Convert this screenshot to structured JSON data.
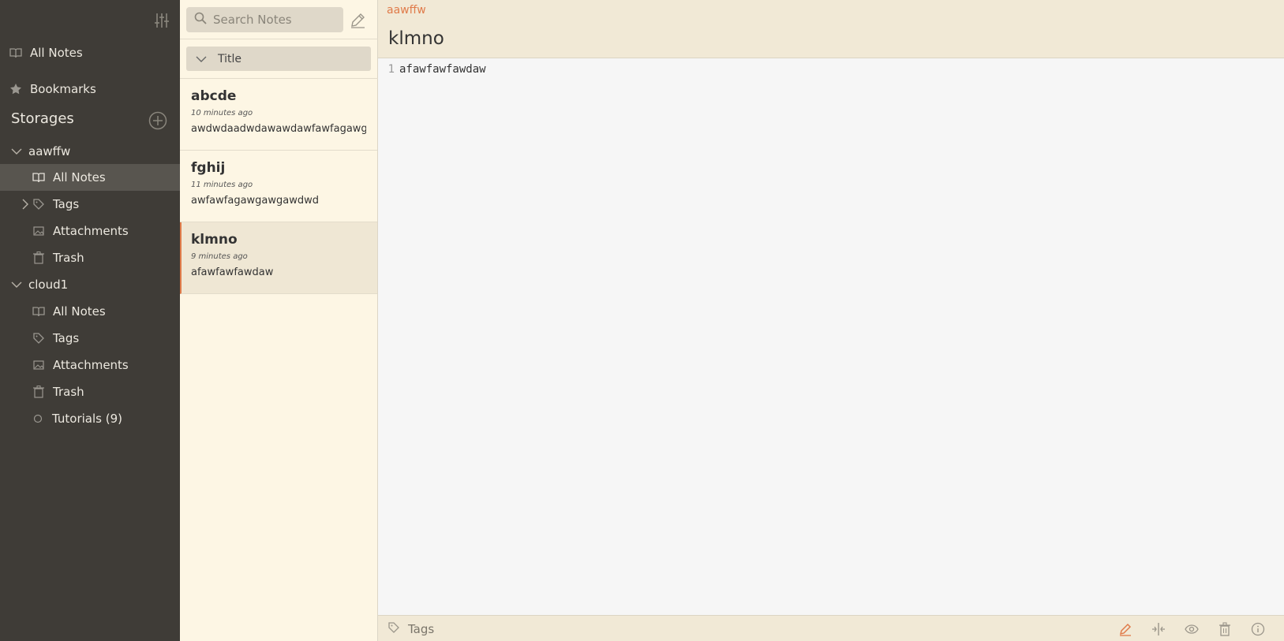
{
  "colors": {
    "sidebar_bg": "#3f3c37",
    "notelist_bg": "#fdf6e4",
    "header_bg": "#f1e9d6",
    "accent": "#e07b4a"
  },
  "sidebar": {
    "toggle_icon": "sliders-icon",
    "all_notes": "All Notes",
    "bookmarks": "Bookmarks",
    "storages_header": "Storages",
    "storages": [
      {
        "name": "aawffw",
        "items": [
          {
            "label": "All Notes",
            "icon": "book-icon"
          },
          {
            "label": "Tags",
            "icon": "tag-icon"
          },
          {
            "label": "Attachments",
            "icon": "image-icon"
          },
          {
            "label": "Trash",
            "icon": "trash-icon"
          }
        ]
      },
      {
        "name": "cloud1",
        "items": [
          {
            "label": "All Notes",
            "icon": "book-icon"
          },
          {
            "label": "Tags",
            "icon": "tag-icon"
          },
          {
            "label": "Attachments",
            "icon": "image-icon"
          },
          {
            "label": "Trash",
            "icon": "trash-icon"
          },
          {
            "label": "Tutorials (9)",
            "icon": "folder-icon"
          }
        ]
      }
    ]
  },
  "notelist": {
    "search_placeholder": "Search Notes",
    "sort_label": "Title",
    "notes": [
      {
        "title": "abcde",
        "time": "10 minutes ago",
        "preview": "awdwdaadwdawawdawfawfagawgawg"
      },
      {
        "title": "fghij",
        "time": "11 minutes ago",
        "preview": "awfawfagawgawgawdwd"
      },
      {
        "title": "klmno",
        "time": "9 minutes ago",
        "preview": "afawfawfawdaw"
      }
    ]
  },
  "editor": {
    "storage_name": "aawffw",
    "title": "klmno",
    "lines": [
      {
        "num": "1",
        "text": "afawfawfawdaw"
      }
    ],
    "tags_label": "Tags"
  }
}
